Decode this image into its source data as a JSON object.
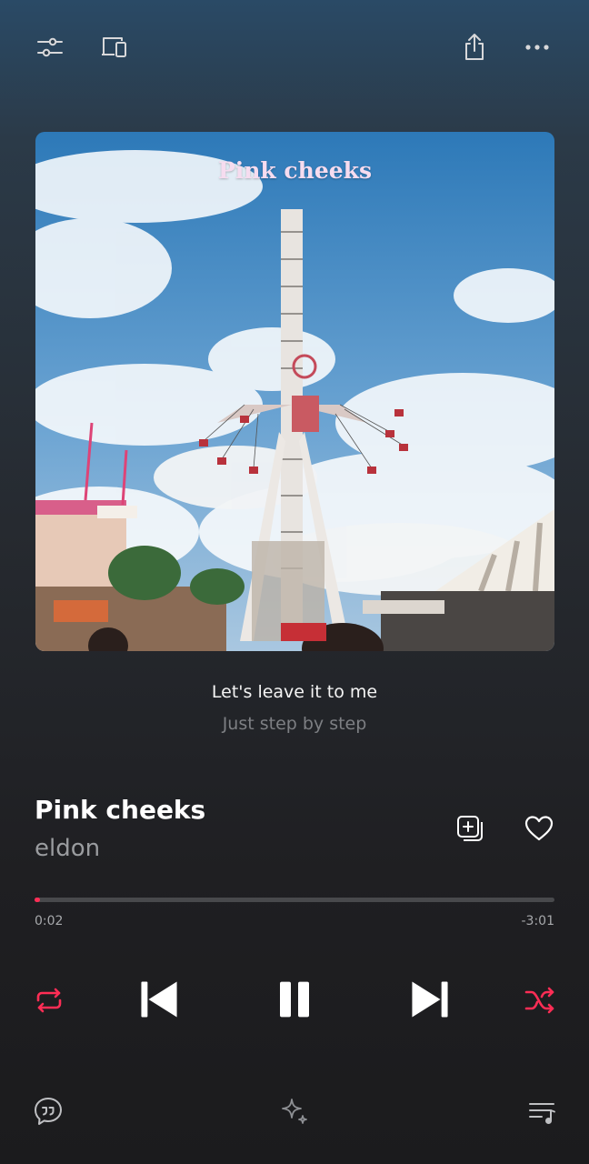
{
  "album": {
    "title": "Pink cheeks"
  },
  "lyrics": {
    "current": "Let's leave it to me",
    "next": "Just step by step"
  },
  "track": {
    "title": "Pink cheeks",
    "artist": "eldon"
  },
  "progress": {
    "elapsed": "0:02",
    "remaining": "-3:01",
    "fraction": 0.011
  },
  "playback": {
    "state": "playing",
    "repeat": "on",
    "shuffle": "on"
  },
  "colors": {
    "accent": "#ff2d55"
  },
  "icons": {
    "top_left": [
      "sliders-icon",
      "devices-icon"
    ],
    "top_right": [
      "share-icon",
      "more-icon"
    ],
    "bottom": [
      "lyrics-quote-icon",
      "sparkle-icon",
      "queue-icon"
    ]
  }
}
